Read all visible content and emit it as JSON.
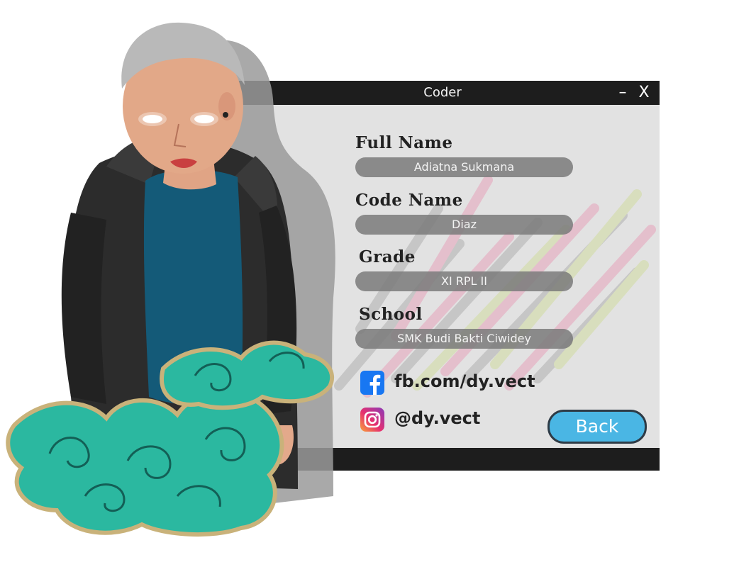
{
  "window": {
    "title": "Coder",
    "minimize_label": "–",
    "close_label": "X"
  },
  "fields": {
    "full_name": {
      "label": "Full Name",
      "value": "Adiatna Sukmana"
    },
    "code_name": {
      "label": "Code Name",
      "value": "Diaz"
    },
    "grade": {
      "label": "Grade",
      "value": "XI RPL II"
    },
    "school": {
      "label": "School",
      "value": "SMK Budi Bakti Ciwidey"
    }
  },
  "social": {
    "facebook": {
      "icon": "facebook-icon",
      "text": "fb.com/dy.vect"
    },
    "instagram": {
      "icon": "instagram-icon",
      "text": "@dy.vect"
    }
  },
  "actions": {
    "back_label": "Back"
  },
  "colors": {
    "titlebar": "#1d1d1d",
    "window_bg": "#e2e2e2",
    "pill": "#7a7a7a",
    "back_button": "#4ab6e4",
    "facebook": "#1877f2",
    "cloud_teal": "#2bb8a0",
    "cloud_gold": "#c9b27a"
  }
}
